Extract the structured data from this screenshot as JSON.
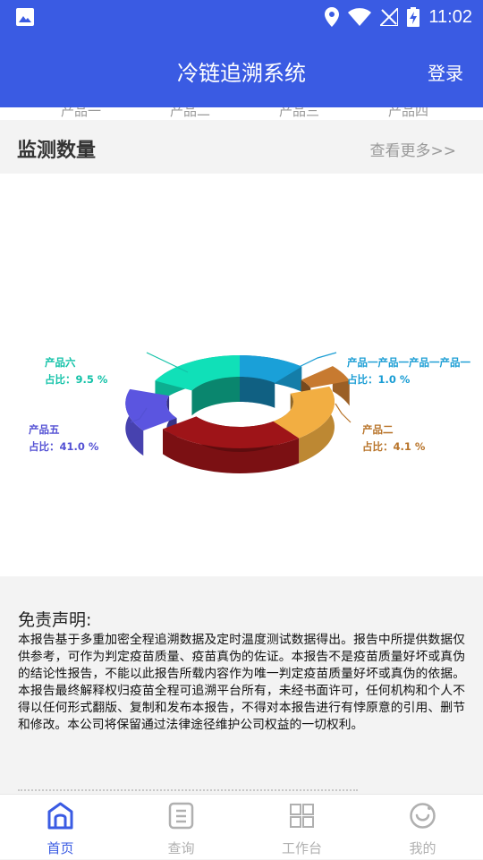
{
  "status_bar": {
    "time": "11:02"
  },
  "app_bar": {
    "title": "冷链追溯系统",
    "login_label": "登录"
  },
  "product_tabs": [
    "产品一",
    "产品二",
    "产品三",
    "产品四"
  ],
  "section": {
    "title": "监测数量",
    "see_more": "查看更多>>"
  },
  "chart_data": {
    "type": "pie",
    "style": "3d-doughnut",
    "slices": [
      {
        "label": "产品一产品一产品一产品一",
        "ratio_text": "占比：1.0 %",
        "value": 1.0,
        "color": "#1a9dd4"
      },
      {
        "label": "产品二",
        "ratio_text": "占比：4.1 %",
        "value": 4.1,
        "color": "#b8742a"
      },
      {
        "label": "产品五",
        "ratio_text": "占比：41.0 %",
        "value": 41.0,
        "color": "#5451d4"
      },
      {
        "label": "产品六",
        "ratio_text": "占比：9.5 %",
        "value": 9.5,
        "color": "#13c2a8"
      }
    ],
    "ring_segment_colors": [
      "#1aa0d8",
      "#c77a30",
      "#f2ae42",
      "#9e1418",
      "#5b55e0",
      "#10e0b8"
    ]
  },
  "disclaimer": {
    "title": "免责声明:",
    "body": "本报告基于多重加密全程追溯数据及定时温度测试数据得出。报告中所提供数据仅供参考，可作为判定疫苗质量、疫苗真伪的佐证。本报告不是疫苗质量好坏或真伪的结论性报告，不能以此报告所载内容作为唯一判定疫苗质量好坏或真伪的依据。本报告最终解释权归疫苗全程可追溯平台所有，未经书面许可，任何机构和个人不得以任何形式翻版、复制和发布本报告，不得对本报告进行有悖原意的引用、删节和修改。本公司将保留通过法律途径维护公司权益的一切权利。"
  },
  "bottom_nav": [
    {
      "label": "首页",
      "icon": "home-icon",
      "active": true
    },
    {
      "label": "查询",
      "icon": "query-icon",
      "active": false
    },
    {
      "label": "工作台",
      "icon": "workbench-icon",
      "active": false
    },
    {
      "label": "我的",
      "icon": "profile-icon",
      "active": false
    }
  ],
  "colors": {
    "primary": "#3a5be3",
    "inactive": "#b0b0b0"
  }
}
